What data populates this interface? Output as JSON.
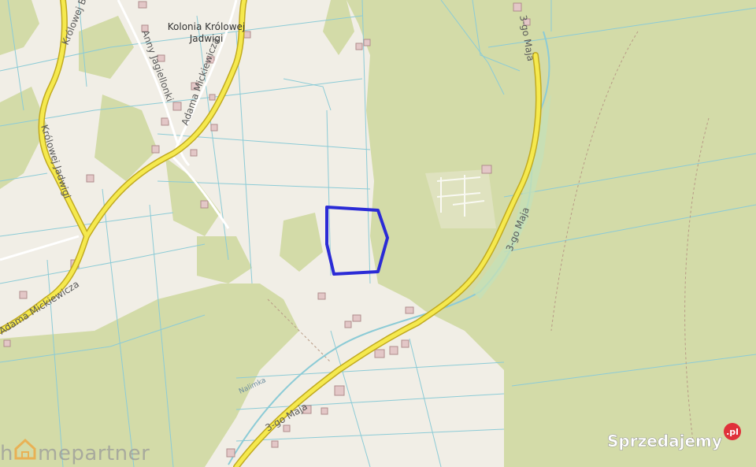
{
  "map": {
    "place_label_line1": "Kolonia Królowej",
    "place_label_line2": "Jadwigi",
    "road_krolowej_jadwigi_top": "Królowej B",
    "road_krolowej_jadwigi": "Królowej Jadwigi",
    "road_anny_jagiellonki": "Anny Jagiellonki",
    "road_adama_mickiewicza_top": "Adama Mickiewicza",
    "road_adama_mickiewicza_left": "Adama Mickiewicza",
    "road_3go_maja_right": "3-go Maja",
    "road_3go_maja_mid": "3-go Maja",
    "road_3go_maja_bottom": "3-go Maja",
    "stream_label": "Nalimka",
    "colors": {
      "background": "#f1eee6",
      "forest": "#d3dba8",
      "main_road": "#f5e94e",
      "road_casing": "#c1aa20",
      "parcel_lines": "#8ccbd6",
      "selection": "#2b2bd6",
      "building": "#c8a5a5"
    }
  },
  "watermark_left": {
    "h": "h",
    "rest": "mepartner"
  },
  "watermark_right": {
    "text": "Sprzedajemy",
    "badge": ".pl"
  }
}
